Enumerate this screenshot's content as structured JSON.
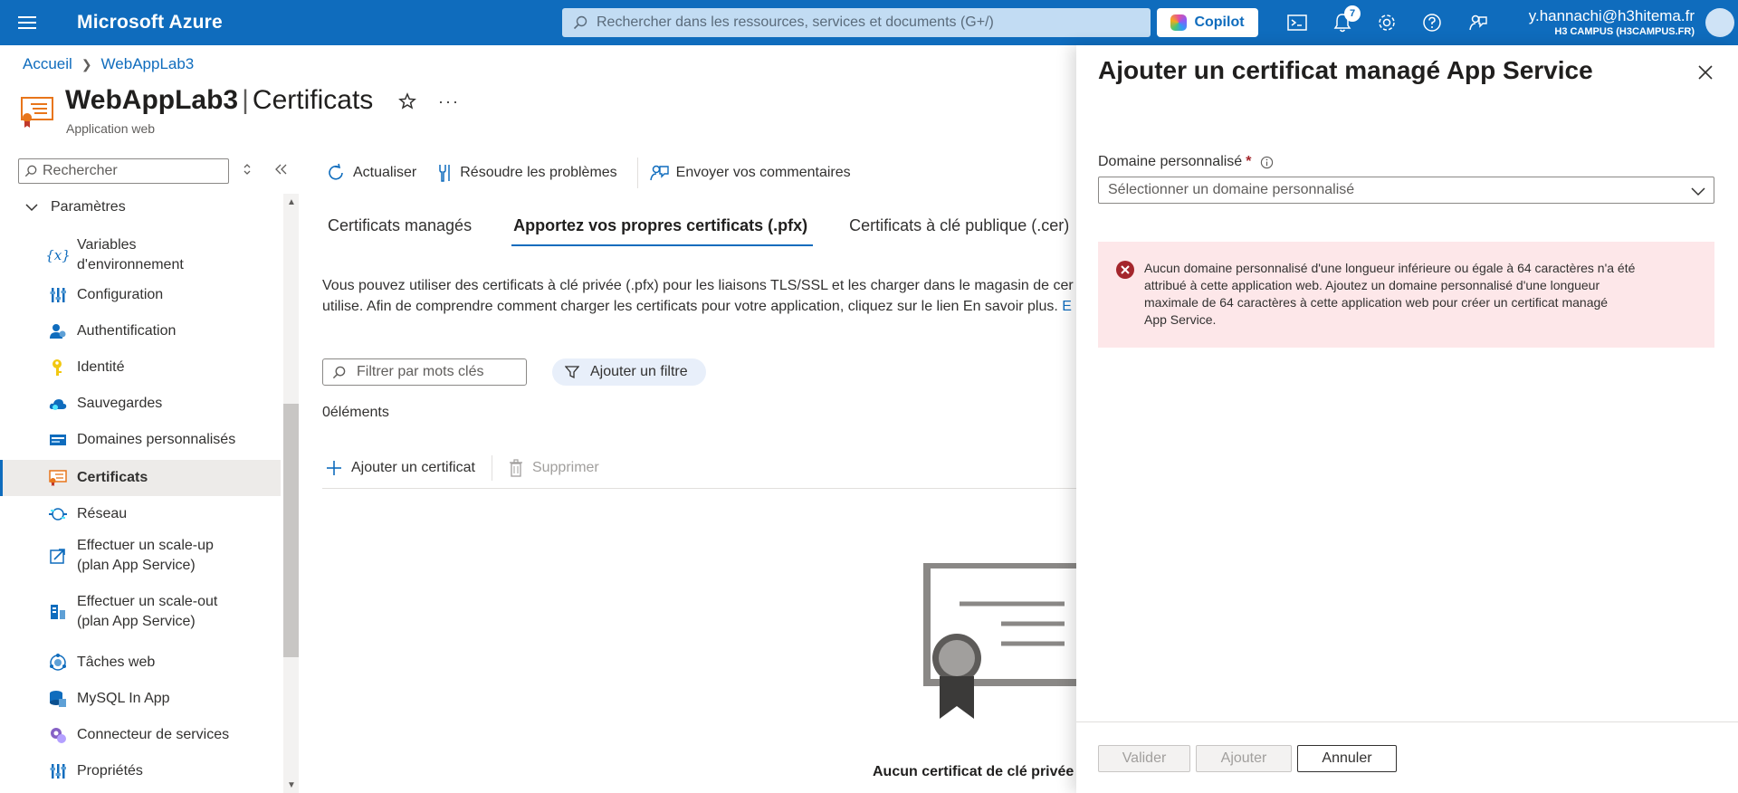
{
  "topbar": {
    "brand": "Microsoft Azure",
    "search_placeholder": "Rechercher dans les ressources, services et documents (G+/)",
    "copilot_label": "Copilot",
    "notifications_count": "7",
    "user_email": "y.hannachi@h3hitema.fr",
    "user_tenant": "H3 CAMPUS (H3CAMPUS.FR)",
    "colors": {
      "bar": "#0f6cbd",
      "accent": "#0f6cbd"
    }
  },
  "breadcrumb": {
    "home": "Accueil",
    "resource": "WebAppLab3"
  },
  "header": {
    "resource_name": "WebAppLab3",
    "separator": "|",
    "page": "Certificats",
    "subtitle": "Application web",
    "more": "···"
  },
  "sidebar": {
    "search_placeholder": "Rechercher",
    "group_label": "Paramètres",
    "items": [
      {
        "label_1": "Variables",
        "label_2": "d'environnement",
        "icon": "variables-icon"
      },
      {
        "label": "Configuration",
        "icon": "configuration-icon"
      },
      {
        "label": "Authentification",
        "icon": "authentication-icon"
      },
      {
        "label": "Identité",
        "icon": "identity-icon"
      },
      {
        "label": "Sauvegardes",
        "icon": "backups-icon"
      },
      {
        "label": "Domaines personnalisés",
        "icon": "custom-domains-icon"
      },
      {
        "label": "Certificats",
        "icon": "certificate-icon",
        "active": true
      },
      {
        "label": "Réseau",
        "icon": "network-icon"
      },
      {
        "label_1": "Effectuer un scale-up",
        "label_2": "(plan App Service)",
        "icon": "scale-up-icon"
      },
      {
        "label_1": "Effectuer un scale-out",
        "label_2": "(plan App Service)",
        "icon": "scale-out-icon"
      },
      {
        "label": "Tâches web",
        "icon": "webjobs-icon"
      },
      {
        "label": "MySQL In App",
        "icon": "mysql-icon"
      },
      {
        "label": "Connecteur de services",
        "icon": "service-connector-icon"
      },
      {
        "label": "Propriétés",
        "icon": "properties-icon"
      }
    ]
  },
  "toolbar": {
    "refresh": "Actualiser",
    "troubleshoot": "Résoudre les problèmes",
    "feedback": "Envoyer vos commentaires"
  },
  "tabs": [
    {
      "label": "Certificats managés",
      "active": false
    },
    {
      "label": "Apportez vos propres certificats (.pfx)",
      "active": true
    },
    {
      "label": "Certificats à clé publique (.cer)",
      "active": false
    }
  ],
  "main": {
    "desc_line1": "Vous pouvez utiliser des certificats à clé privée (.pfx) pour les liaisons TLS/SSL et les charger dans le magasin de certif",
    "desc_line2": "utilise. Afin de comprendre comment charger les certificats pour votre application, cliquez sur le lien En savoir plus. ",
    "desc_link": "E",
    "filter_placeholder": "Filtrer par mots clés",
    "add_filter": "Ajouter un filtre",
    "count": "0éléments",
    "add_cert": "Ajouter un certificat",
    "delete": "Supprimer",
    "empty_title": "Aucun certificat de clé privée"
  },
  "panel": {
    "title": "Ajouter un certificat managé App Service",
    "field_label": "Domaine personnalisé",
    "required_mark": "*",
    "dropdown_placeholder": "Sélectionner un domaine personnalisé",
    "error_line1": "Aucun domaine personnalisé d'une longueur inférieure ou égale à 64 caractères n'a été",
    "error_line2": "attribué à cette application web. Ajoutez un domaine personnalisé d'une longueur",
    "error_line3": "maximale de 64 caractères à cette application web pour créer un certificat managé",
    "error_line4": "App Service.",
    "btn_validate": "Valider",
    "btn_add": "Ajouter",
    "btn_cancel": "Annuler"
  }
}
